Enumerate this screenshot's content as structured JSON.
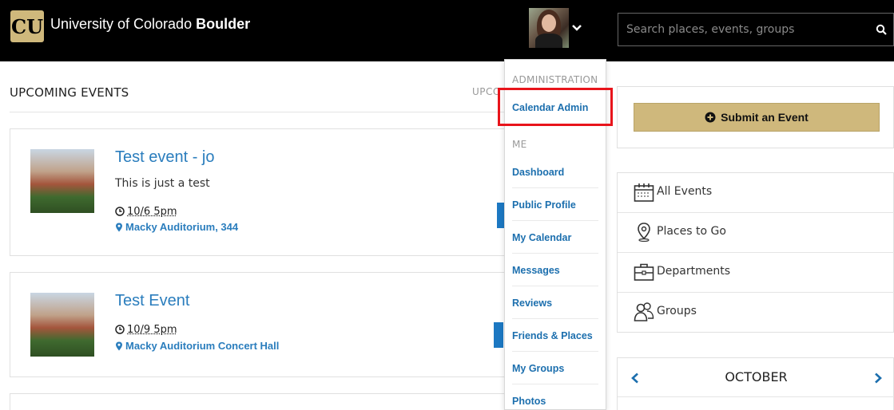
{
  "header": {
    "brand_prefix": "University of Colorado ",
    "brand_bold": "Boulder",
    "logo_letters": "CU",
    "search_placeholder": "Search places, events, groups"
  },
  "main": {
    "section_title": "UPCOMING EVENTS",
    "section_tab_partial": "UPCO",
    "events": [
      {
        "title": "Test event - jo",
        "description": "This is just a test",
        "when": "10/6 5pm",
        "where": "Macky Auditorium, 344"
      },
      {
        "title": "Test Event",
        "description": "",
        "when": "10/9 5pm",
        "where": "Macky Auditorium Concert Hall"
      }
    ]
  },
  "dropdown": {
    "admin_heading": "ADMINISTRATION",
    "admin_items": [
      "Calendar Admin"
    ],
    "me_heading": "ME",
    "me_items": [
      "Dashboard",
      "Public Profile",
      "My Calendar",
      "Messages",
      "Reviews",
      "Friends & Places",
      "My Groups",
      "Photos"
    ]
  },
  "sidebar": {
    "submit_label": "Submit an Event",
    "nav": [
      {
        "label": "All Events",
        "icon": "calendar-icon"
      },
      {
        "label": "Places to Go",
        "icon": "map-pin-icon"
      },
      {
        "label": "Departments",
        "icon": "briefcase-icon"
      },
      {
        "label": "Groups",
        "icon": "users-icon"
      }
    ],
    "calendar_month": "OCTOBER"
  },
  "colors": {
    "header_bg": "#000000",
    "link_blue": "#1c6fae",
    "gold": "#cfb87c",
    "highlight_red": "#e8141b"
  }
}
